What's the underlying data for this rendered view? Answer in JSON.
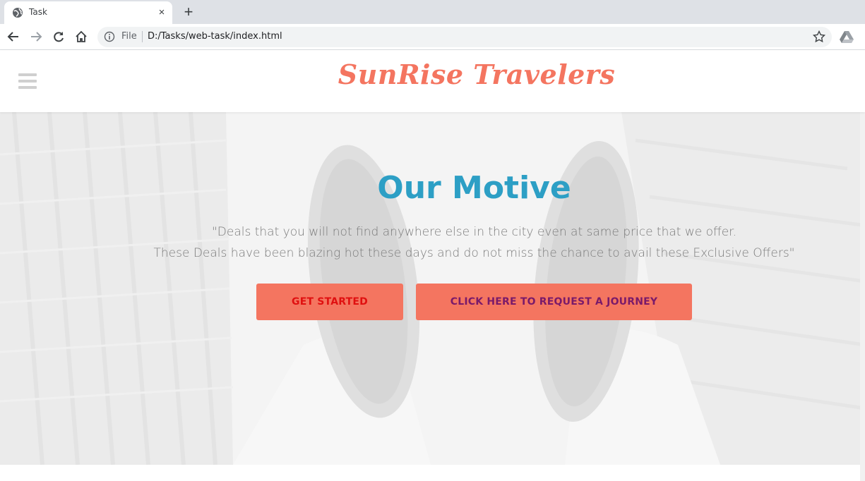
{
  "browser": {
    "tab_title": "Task",
    "tab_close": "×",
    "new_tab": "+",
    "address": {
      "scheme_label": "File",
      "url": "D:/Tasks/web-task/index.html"
    },
    "icons": [
      "globe-icon",
      "close-icon",
      "plus-icon",
      "back-arrow-icon",
      "forward-arrow-icon",
      "reload-icon",
      "home-icon",
      "info-icon",
      "star-icon",
      "drive-icon"
    ]
  },
  "site": {
    "brand": "SunRise Travelers",
    "menu_icon": "hamburger-icon",
    "hero": {
      "title": "Our Motive",
      "line1": "\"Deals that you will not find anywhere else in the city even at same price that we offer.",
      "line2": "These Deals have been blazing hot these days and do not miss the chance to avail these Exclusive Offers\"",
      "primary_button": "GET STARTED",
      "secondary_button": "CLICK HERE TO REQUEST A JOURNEY"
    }
  },
  "colors": {
    "brand": "#f47560",
    "title": "#2d9fc5",
    "button_bg": "#f47560",
    "primary_button_text": "#e01010",
    "secondary_button_text": "#7a1a6a",
    "tabstrip": "#dee1e6"
  }
}
